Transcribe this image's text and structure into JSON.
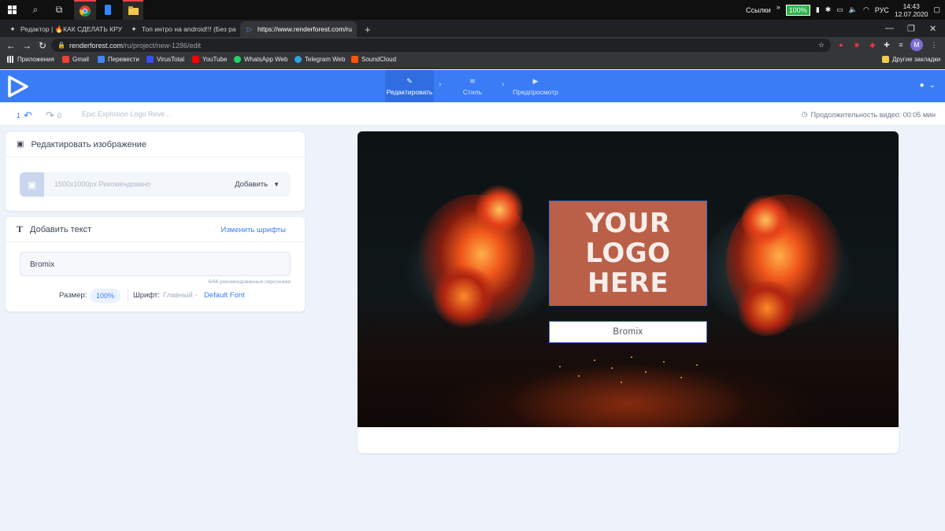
{
  "taskbar": {
    "links_label": "Ссылки",
    "more": "»",
    "battery": "100%",
    "lang": "РУС",
    "time": "14:43",
    "date": "12.07.2020"
  },
  "tabs": [
    {
      "title": "Редактор | 🔥КАК СДЕЛАТЬ КРУ",
      "icon": "renderforest-icon"
    },
    {
      "title": "Топ интро на android!!! (Без ра",
      "icon": "renderforest-icon"
    },
    {
      "title": "https://www.renderforest.com/ru",
      "icon": "play-icon"
    }
  ],
  "new_tab": "+",
  "omnibox": {
    "host": "renderforest.com",
    "path": "/ru/project/new-1286/edit"
  },
  "bookmarks": [
    {
      "label": "Приложения",
      "color": "#e8eaed"
    },
    {
      "label": "Gmail",
      "color": "#ea4335"
    },
    {
      "label": "Перевести",
      "color": "#4285f4"
    },
    {
      "label": "VirusTotal",
      "color": "#394eff"
    },
    {
      "label": "YouTube",
      "color": "#ff0000"
    },
    {
      "label": "WhatsApp Web",
      "color": "#25d366"
    },
    {
      "label": "Telegram Web",
      "color": "#2ca5e0"
    },
    {
      "label": "SoundCloud",
      "color": "#ff5500"
    }
  ],
  "other_bookmarks": "Другие закладки",
  "app": {
    "accent": "#3a7cf6",
    "steps": [
      {
        "label": "Редактировать",
        "icon": "pencil-icon"
      },
      {
        "label": "Стиль",
        "icon": "layers-icon"
      },
      {
        "label": "Предпросмотр",
        "icon": "play-icon"
      }
    ]
  },
  "subbar": {
    "undo_count": "1",
    "redo_count": "0",
    "project_title": "Epic Explosion Logo Reve...",
    "duration": "Продолжительность видео: 00:05 мин"
  },
  "image_panel": {
    "title": "Редактировать изображение",
    "hint": "1500x1000px Рекомендовано",
    "add_label": "Добавить"
  },
  "text_panel": {
    "title": "Добавить текст",
    "change_fonts": "Изменить шрифты",
    "value": "Bromix",
    "counter": "6/66 рекомендованные персонажи",
    "size_label": "Размер:",
    "size_value": "100%",
    "font_label": "Шрифт:",
    "font_main": "Главный -",
    "font_value": "Default Font"
  },
  "preview": {
    "logo_text": "YOUR LOGO HERE",
    "name_text": "Bromix"
  }
}
